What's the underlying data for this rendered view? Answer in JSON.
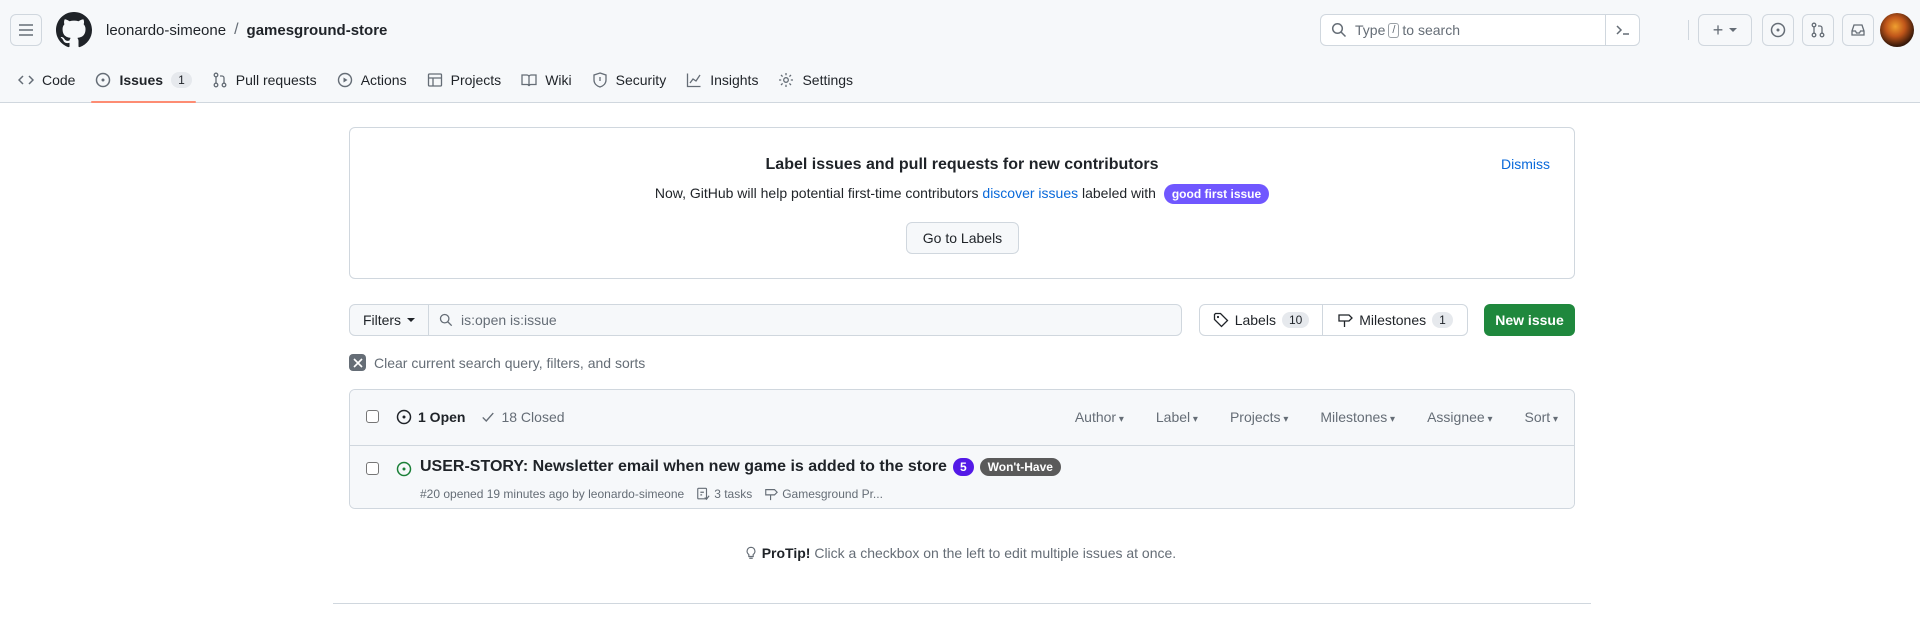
{
  "header": {
    "owner": "leonardo-simeone",
    "separator": "/",
    "repo": "gamesground-store",
    "search_prefix": "Type",
    "search_key": "/",
    "search_suffix": "to search",
    "plus_label": "+"
  },
  "nav": {
    "code": "Code",
    "issues": "Issues",
    "issues_count": "1",
    "pulls": "Pull requests",
    "actions": "Actions",
    "projects": "Projects",
    "wiki": "Wiki",
    "security": "Security",
    "insights": "Insights",
    "settings": "Settings"
  },
  "banner": {
    "title": "Label issues and pull requests for new contributors",
    "desc_before": "Now, GitHub will help potential first-time contributors",
    "desc_link": "discover issues",
    "desc_after": "labeled with",
    "label": "good first issue",
    "button": "Go to Labels",
    "dismiss": "Dismiss"
  },
  "filterbar": {
    "filters": "Filters",
    "query": "is:open is:issue",
    "labels": "Labels",
    "labels_count": "10",
    "milestones": "Milestones",
    "milestones_count": "1",
    "new_issue": "New issue",
    "clear": "Clear current search query, filters, and sorts"
  },
  "list": {
    "open": "1 Open",
    "closed": "18 Closed",
    "sorters": [
      "Author",
      "Label",
      "Projects",
      "Milestones",
      "Assignee",
      "Sort"
    ],
    "issue": {
      "title": "USER-STORY: Newsletter email when new game is added to the store",
      "label_num": "5",
      "label_wh": "Won't-Have",
      "meta": "#20 opened 19 minutes ago by leonardo-simeone",
      "tasks": "3 tasks",
      "project": "Gamesground Pr..."
    }
  },
  "protip": {
    "strong": "ProTip!",
    "text": "Click a checkbox on the left to edit multiple issues at once."
  },
  "colors": {
    "accent": "#1f883d",
    "tab_underline": "#fd8c73",
    "link": "#0969da",
    "label_good_first_issue": "#7057ff",
    "label_5": "#5319e7",
    "label_wont_have": "#5a5a5a"
  }
}
